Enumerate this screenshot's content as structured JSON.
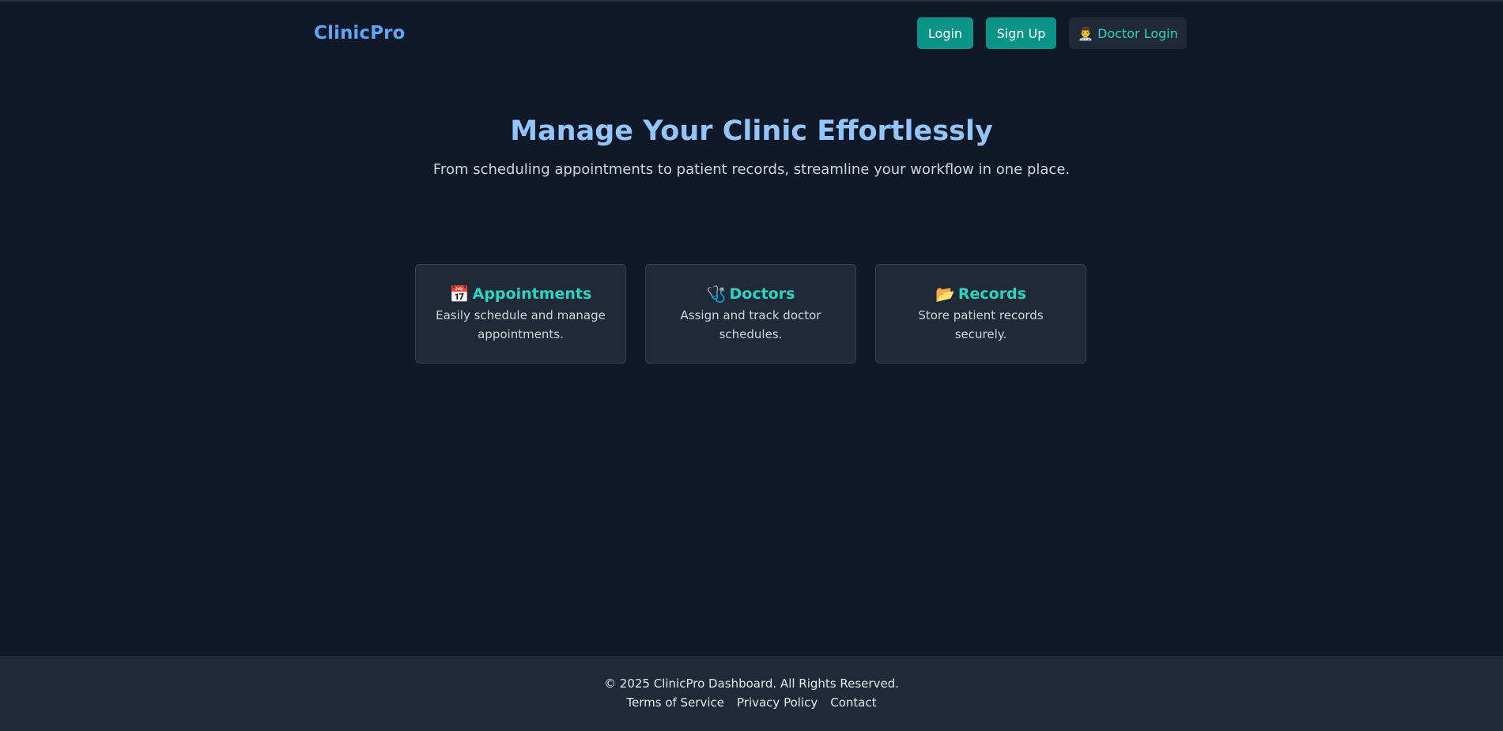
{
  "header": {
    "brand": "ClinicPro",
    "login_label": "Login",
    "signup_label": "Sign Up",
    "doctor_login_emoji": "👨‍⚕️",
    "doctor_login_label": "Doctor Login"
  },
  "hero": {
    "title": "Manage Your Clinic Effortlessly",
    "subtitle": "From scheduling appointments to patient records, streamline your workflow in one place."
  },
  "features": [
    {
      "emoji": "📅",
      "title": "Appointments",
      "description": "Easily schedule and manage appointments.",
      "icon": "calendar-icon"
    },
    {
      "emoji": "🩺",
      "title": "Doctors",
      "description": "Assign and track doctor schedules.",
      "icon": "stethoscope-icon"
    },
    {
      "emoji": "📂",
      "title": "Records",
      "description": "Store patient records securely.",
      "icon": "folder-icon"
    }
  ],
  "footer": {
    "copyright": "© 2025 ClinicPro Dashboard. All Rights Reserved.",
    "links": [
      "Terms of Service",
      "Privacy Policy",
      "Contact"
    ]
  },
  "colors": {
    "background": "#111827",
    "surface": "#1f2937",
    "accent": "#0d9488",
    "brand": "#60a5fa",
    "heading": "#93c5fd",
    "teal_text": "#2dd4bf"
  }
}
